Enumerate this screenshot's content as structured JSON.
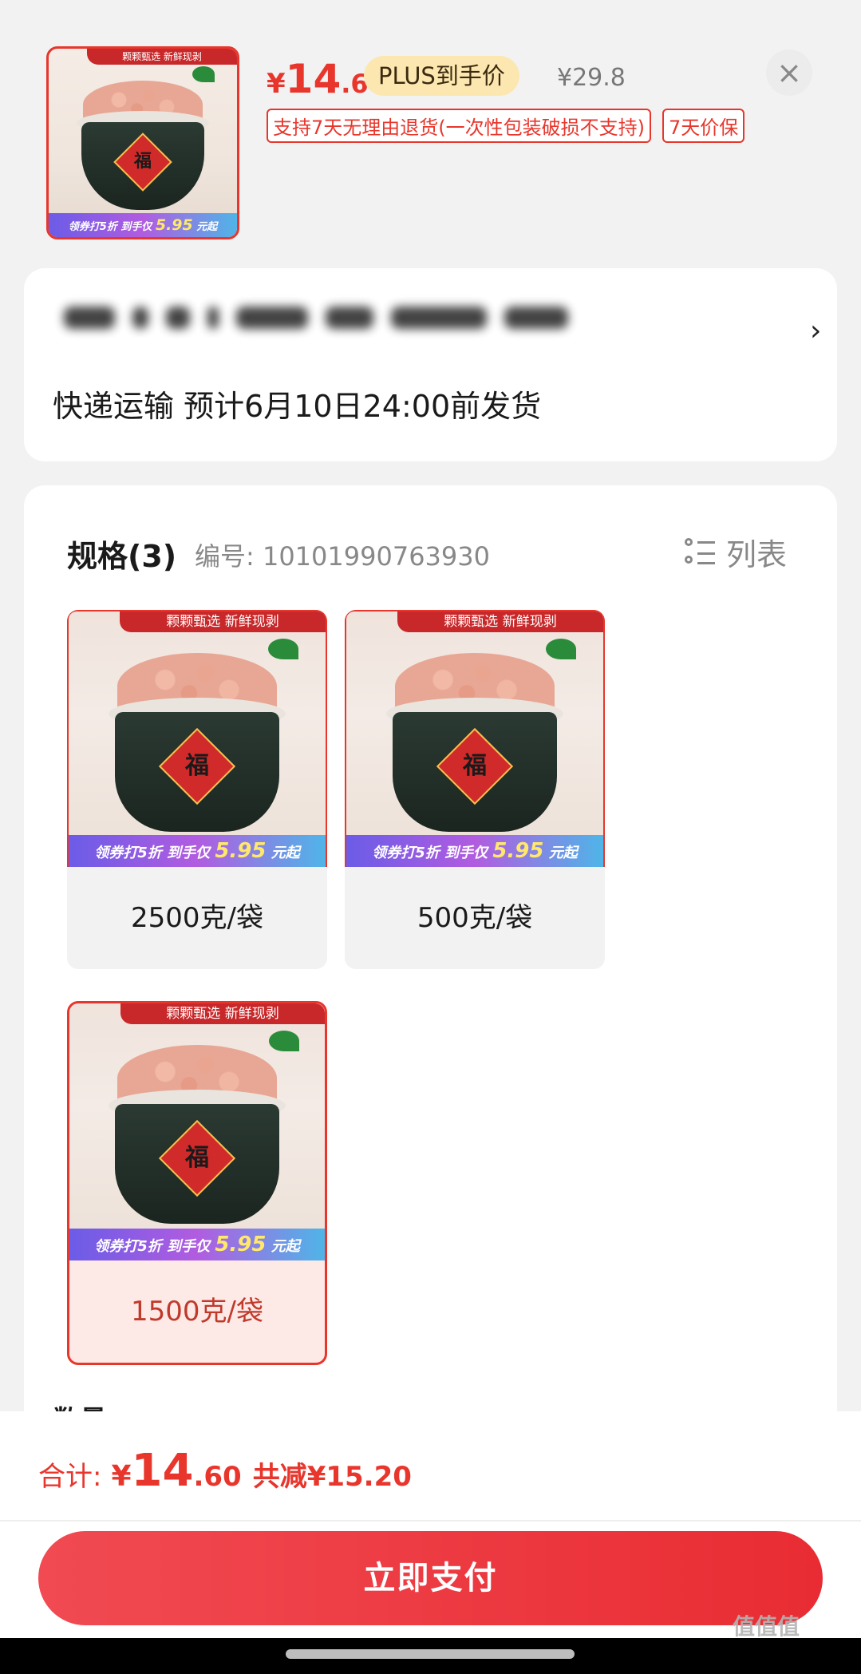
{
  "header": {
    "price_symbol": "¥",
    "price_integer": "14",
    "price_decimal": ".6",
    "plus_label": "PLUS到手价",
    "original_price": "¥29.8",
    "close_icon": "close-icon",
    "tags": [
      "支持7天无理由退货(一次性包装破损不支持)",
      "7天价保"
    ]
  },
  "product_image": {
    "top_banner": "颗颗甄选 新鲜现剥",
    "bottom_prefix": "领券打5折 到手仅 ",
    "bottom_price": "5.95",
    "bottom_suffix": " 元起",
    "badge_char": "福"
  },
  "address": {
    "arrow_icon": "chevron-right-icon",
    "shipping": "快递运输 预计6月10日24:00前发货"
  },
  "spec": {
    "title": "规格(3)",
    "sku_id": "编号: 10101990763930",
    "list_label": "列表",
    "list_icon": "list-icon",
    "options": [
      {
        "label": "2500克/袋",
        "selected": false
      },
      {
        "label": "500克/袋",
        "selected": false
      },
      {
        "label": "1500克/袋",
        "selected": true
      }
    ]
  },
  "quantity": {
    "label": "数量"
  },
  "footer": {
    "total_label": "合计:",
    "total_symbol": "¥",
    "total_integer": "14",
    "total_decimal": ".60",
    "total_saved": "共减¥15.20",
    "pay_button": "立即支付"
  },
  "watermark": "值值值",
  "colors": {
    "accent": "#e8362c",
    "plus_pill": "#fde7b0",
    "selected_bg": "#fde9e6"
  }
}
